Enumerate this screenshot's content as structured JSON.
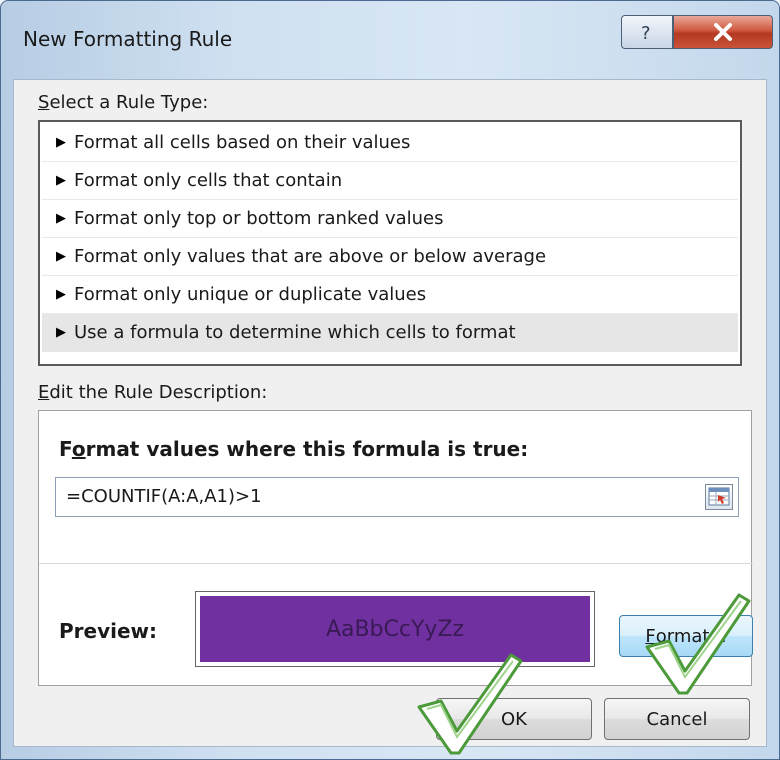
{
  "window": {
    "title": "New Formatting Rule"
  },
  "rule_type": {
    "label": "Select a Rule Type:",
    "items": [
      "Format all cells based on their values",
      "Format only cells that contain",
      "Format only top or bottom ranked values",
      "Format only values that are above or below average",
      "Format only unique or duplicate values",
      "Use a formula to determine which cells to format"
    ],
    "selected_index": 5
  },
  "description": {
    "label": "Edit the Rule Description:",
    "heading": "Format values where this formula is true:",
    "formula": "=COUNTIF(A:A,A1)>1",
    "preview_label": "Preview:",
    "preview_text": "AaBbCcYyZz",
    "preview_fill": "#7030a0",
    "format_button": "Format..."
  },
  "buttons": {
    "ok": "OK",
    "cancel": "Cancel"
  },
  "icons": {
    "help": "help-icon",
    "close": "close-icon",
    "collapse_dialog": "range-selector-icon",
    "list_bullet": "triangle-right-icon",
    "annotation": "checkmark-icon"
  }
}
